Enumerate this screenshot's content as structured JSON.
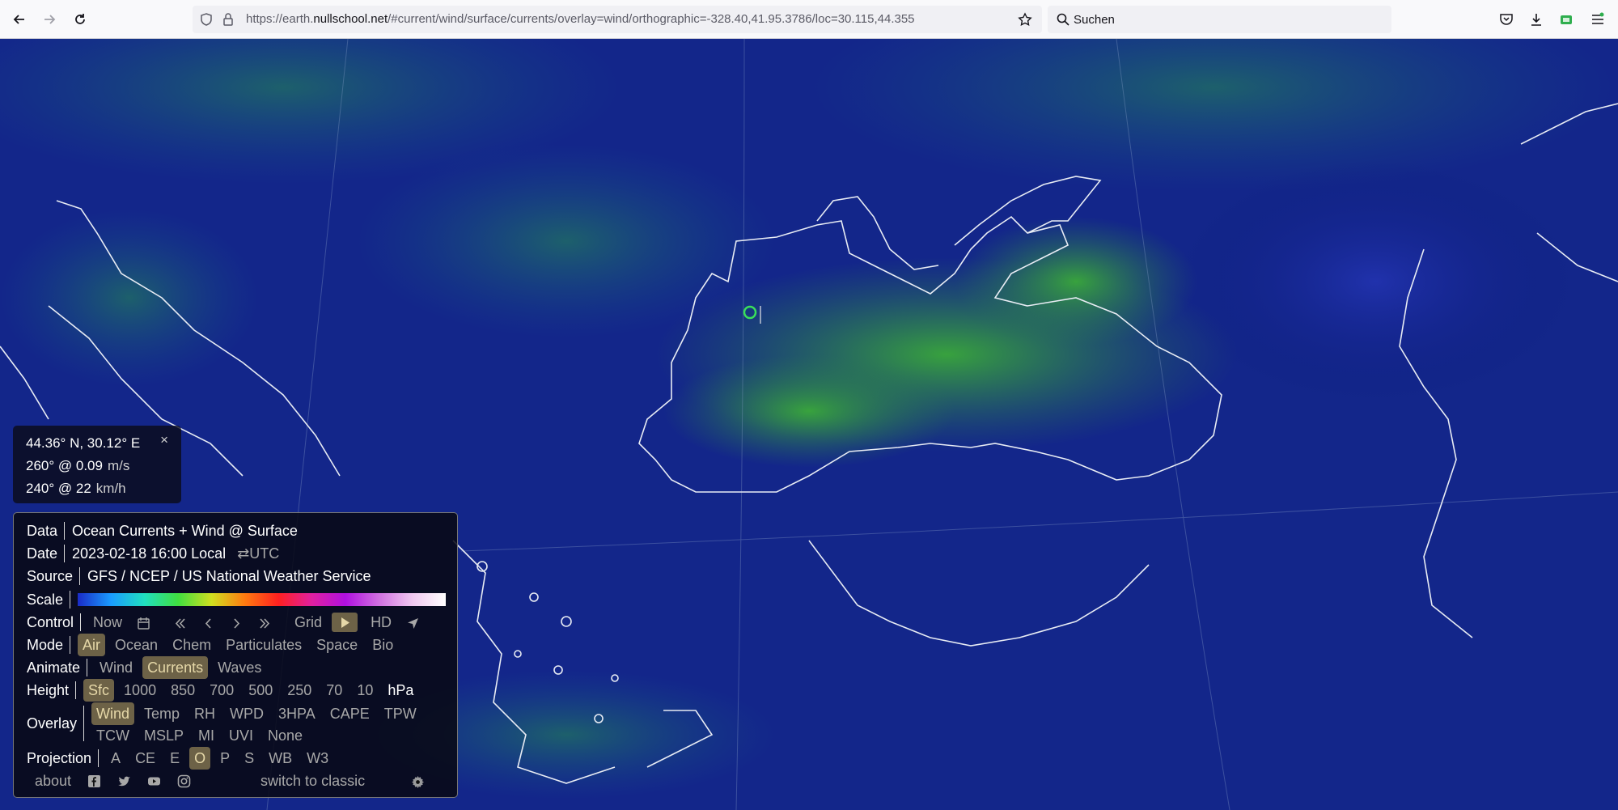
{
  "browser": {
    "url_prefix": "https://earth.",
    "url_domain": "nullschool.net",
    "url_rest": "/#current/wind/surface/currents/overlay=wind/orthographic=-328.40,41.95.3786/loc=30.115,44.355",
    "search_placeholder": "Suchen",
    "icons": [
      "back-arrow-icon",
      "forward-arrow-icon",
      "reload-icon",
      "shield-icon",
      "lock-icon",
      "star-icon",
      "search-icon",
      "pocket-icon",
      "download-icon",
      "extension-icon",
      "menu-icon"
    ]
  },
  "location": {
    "coords": "44.36° N, 30.12° E",
    "close": "×",
    "current_value": "260° @ 0.09",
    "current_unit": "m/s",
    "wind_value": "240° @ 22",
    "wind_unit": "km/h"
  },
  "menu": {
    "data": {
      "label": "Data",
      "value": "Ocean Currents + Wind @ Surface"
    },
    "date": {
      "label": "Date",
      "value": "2023-02-18 16:00 Local",
      "toggle": "⇄UTC"
    },
    "source": {
      "label": "Source",
      "value": "GFS / NCEP / US National Weather Service"
    },
    "scale": {
      "label": "Scale"
    },
    "control": {
      "label": "Control",
      "now": "Now",
      "grid": "Grid",
      "hd": "HD"
    },
    "mode": {
      "label": "Mode",
      "options": [
        "Air",
        "Ocean",
        "Chem",
        "Particulates",
        "Space",
        "Bio"
      ],
      "selected": "Air"
    },
    "animate": {
      "label": "Animate",
      "options": [
        "Wind",
        "Currents",
        "Waves"
      ],
      "selected": "Currents"
    },
    "height": {
      "label": "Height",
      "options": [
        "Sfc",
        "1000",
        "850",
        "700",
        "500",
        "250",
        "70",
        "10"
      ],
      "unit": "hPa",
      "selected": "Sfc"
    },
    "overlay": {
      "label": "Overlay",
      "row1": [
        "Wind",
        "Temp",
        "RH",
        "WPD",
        "3HPA",
        "CAPE",
        "TPW"
      ],
      "row2": [
        "TCW",
        "MSLP",
        "MI",
        "UVI",
        "None"
      ],
      "selected": "Wind"
    },
    "projection": {
      "label": "Projection",
      "options": [
        "A",
        "CE",
        "E",
        "O",
        "P",
        "S",
        "WB",
        "W3"
      ],
      "selected": "O"
    },
    "footer": {
      "about": "about",
      "switch": "switch to classic"
    }
  },
  "colors": {
    "ocean_deep": "#0b1a7a",
    "current_green": "#2e8a3a",
    "selected_bg": "#6d6247",
    "coastline": "#e8ecf4"
  }
}
